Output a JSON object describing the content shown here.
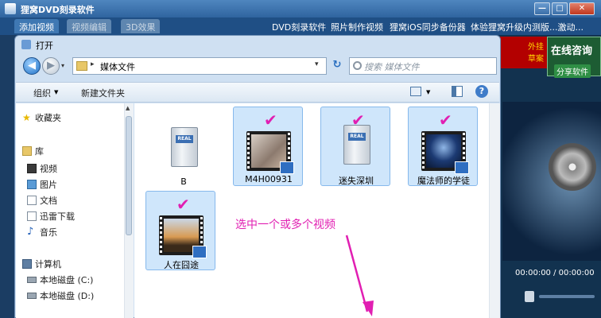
{
  "app": {
    "title": "狸窝DVD刻录软件",
    "tabs": [
      "添加视频",
      "视频编辑",
      "3D效果"
    ],
    "links": [
      "DVD刻录软件",
      "照片制作视频",
      "狸窝iOS同步备份器",
      "体验狸窝升级内测版...激动..."
    ],
    "window_buttons": {
      "minimize": "—",
      "maximize": "□",
      "close": "✕"
    },
    "ad_text": [
      "外挂",
      "草案"
    ],
    "consult": {
      "title": "在线咨询",
      "share": "分享软件"
    },
    "time": "00:00:00 / 00:00:00"
  },
  "dialog": {
    "title": "打开",
    "nav": {
      "back": "◀",
      "forward": "▶",
      "dropdown": "▾",
      "sep": "▸",
      "crumb": "媒体文件",
      "refresh": "↻"
    },
    "search_placeholder": "搜索 媒体文件",
    "toolbar": {
      "organize": "组织",
      "dropdown": "▼",
      "new_folder": "新建文件夹",
      "help": "?"
    },
    "nav_items": [
      {
        "label": "收藏夹",
        "icon": "star-icon"
      },
      {
        "label": "库",
        "icon": "library-icon"
      },
      {
        "label": "视频",
        "icon": "video-icon"
      },
      {
        "label": "图片",
        "icon": "picture-icon"
      },
      {
        "label": "文档",
        "icon": "document-icon"
      },
      {
        "label": "迅雷下载",
        "icon": "download-icon"
      },
      {
        "label": "音乐",
        "icon": "music-icon"
      },
      {
        "label": "计算机",
        "icon": "computer-icon"
      },
      {
        "label": "本地磁盘 (C:)",
        "icon": "disk-icon"
      },
      {
        "label": "本地磁盘 (D:)",
        "icon": "disk-icon"
      }
    ],
    "files": [
      {
        "name": "B",
        "selected": false,
        "type": "real"
      },
      {
        "name": "M4H00931",
        "selected": true,
        "type": "video"
      },
      {
        "name": "迷失深圳",
        "selected": true,
        "type": "real"
      },
      {
        "name": "魔法师的学徒",
        "selected": true,
        "type": "video"
      },
      {
        "name": "人在囧途",
        "selected": true,
        "type": "video"
      }
    ],
    "check_mark": "✔",
    "annotation": "选中一个或多个视频"
  }
}
